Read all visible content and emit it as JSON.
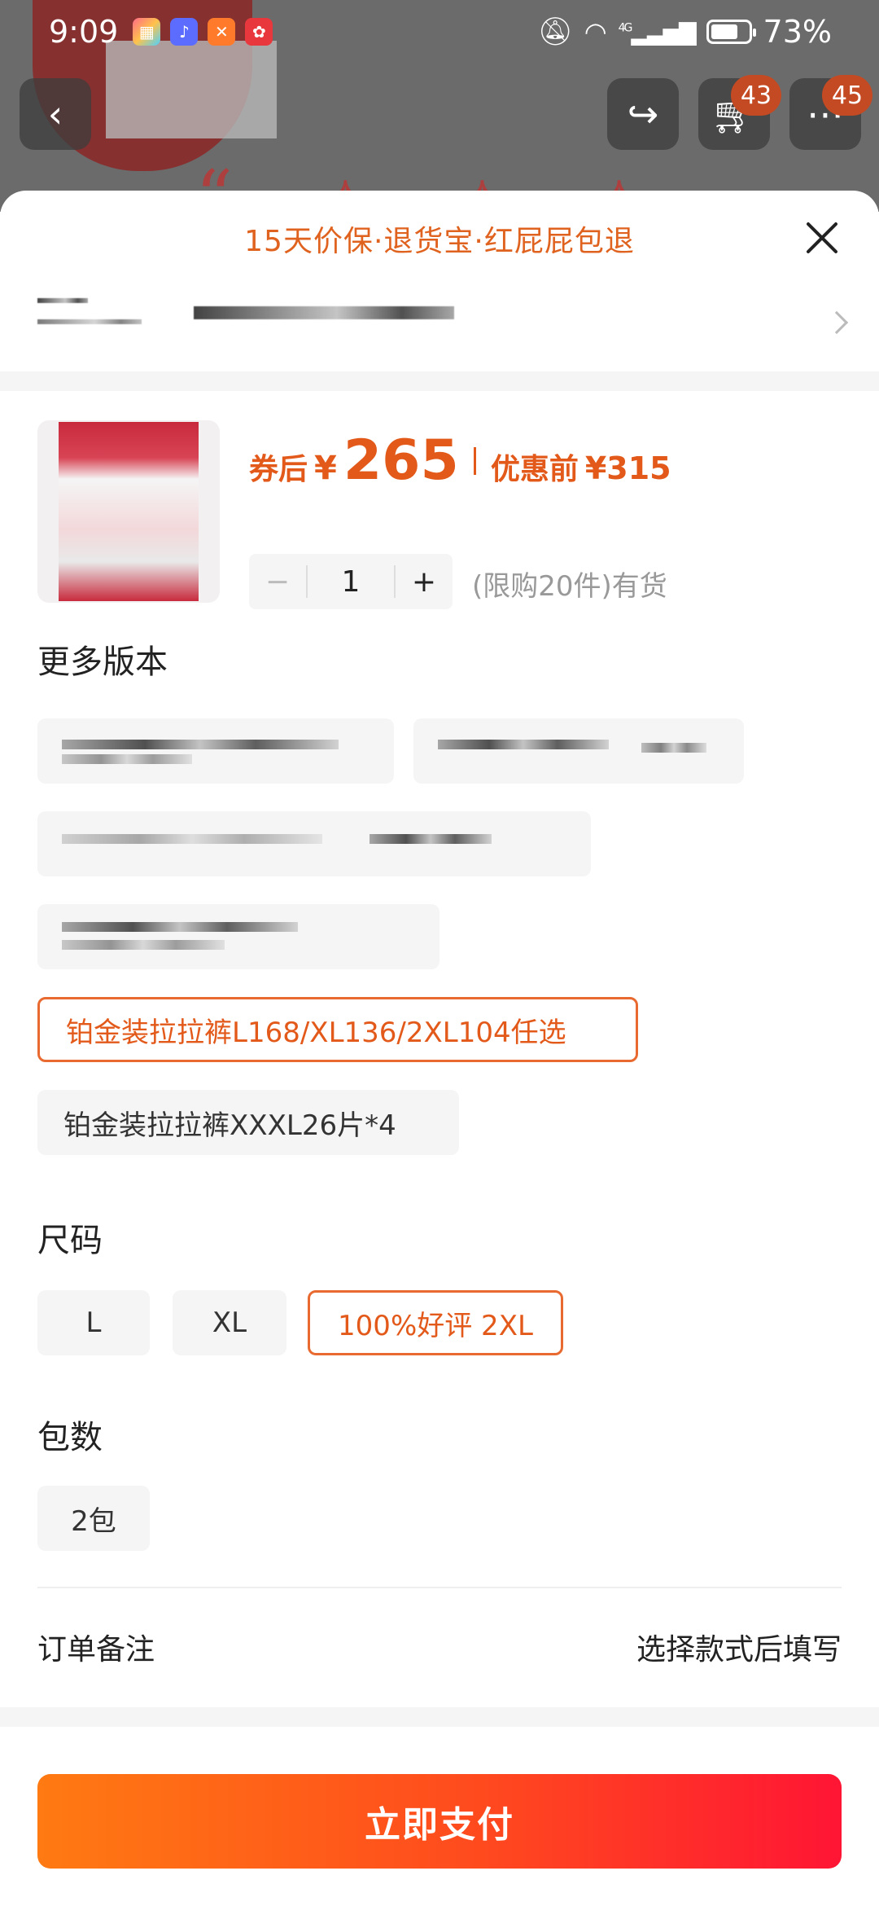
{
  "status_bar": {
    "time": "9:09",
    "battery_percent": "73%",
    "battery_level": 0.73,
    "network": "4G"
  },
  "background_page": {
    "cart_badge": "43",
    "more_badge": "45"
  },
  "sheet": {
    "guarantee_text": "15天价保·退货宝·红屁屁包退",
    "product": {
      "price_label": "券后",
      "currency": "¥",
      "price": "265",
      "pre_discount_label": "优惠前",
      "pre_discount_price": "¥315",
      "quantity": "1",
      "minus_label": "−",
      "plus_label": "+",
      "stock_note": "(限购20件)有货"
    },
    "versions": {
      "title": "更多版本",
      "selected_option": "铂金装拉拉裤L168/XL136/2XL104任选",
      "other_option": "铂金装拉拉裤XXXL26片*4"
    },
    "sizes": {
      "title": "尺码",
      "options": [
        "L",
        "XL",
        "100%好评  2XL"
      ],
      "selected": "100%好评  2XL"
    },
    "packs": {
      "title": "包数",
      "options": [
        "2包"
      ]
    },
    "order_note": {
      "label": "订单备注",
      "hint": "选择款式后填写"
    },
    "pay_button": "立即支付"
  },
  "colors": {
    "accent": "#e2591a",
    "pay_gradient_start": "#ff7a12",
    "pay_gradient_end": "#ff1534",
    "chip_bg": "#f5f5f5"
  }
}
